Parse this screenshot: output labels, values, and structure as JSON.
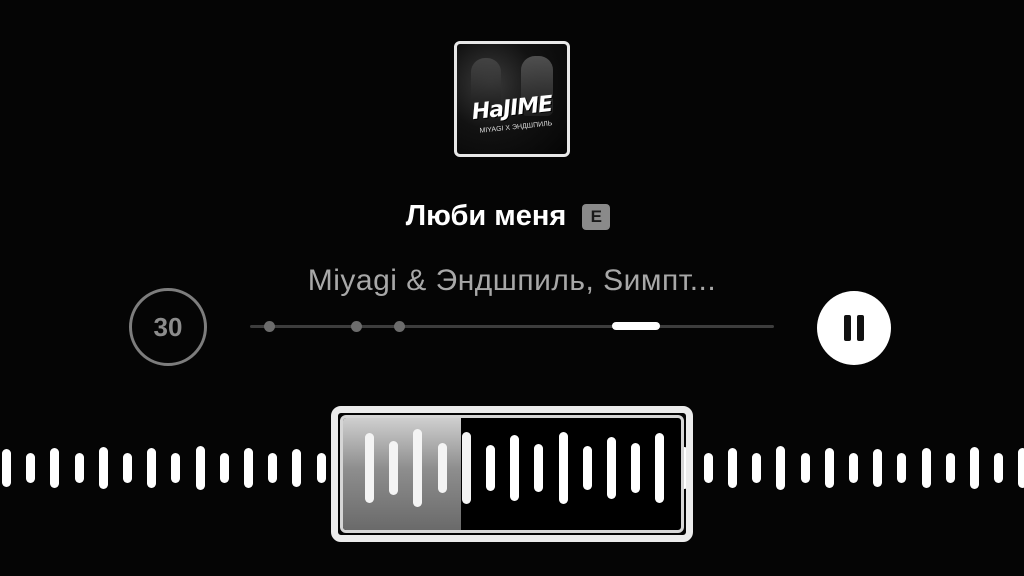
{
  "track": {
    "title": "Люби меня",
    "explicit_badge": "E",
    "artist": "Miyagi & Эндшпиль, Sимпт..."
  },
  "album_art": {
    "logo_text": "HaJIME",
    "logo_subtext": "MIYAGI X ЭНДШПИЛЬ"
  },
  "controls": {
    "skip_back_label": "30",
    "skip_back_icon": "skip-back-30-icon",
    "pause_icon": "pause-icon"
  },
  "selection": {
    "played_fraction": 0.35
  }
}
